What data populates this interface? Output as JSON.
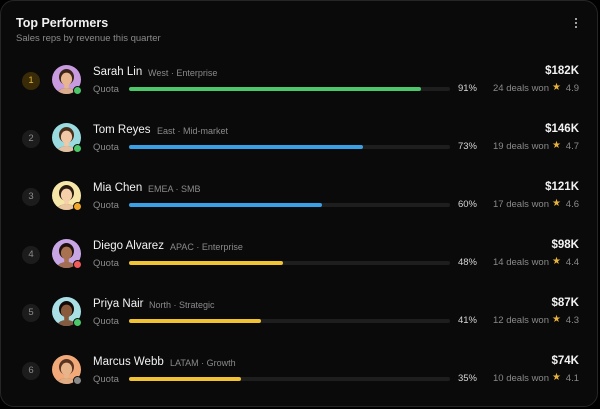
{
  "widget": {
    "title": "Top Performers",
    "subtitle": "Sales reps by revenue this quarter",
    "menu_icon": "more-vertical-icon"
  },
  "colors": {
    "green": "#4cc86a",
    "blue": "#3aa0e6",
    "yellow": "#f1c232",
    "status_online": "#4cc86a",
    "status_away": "#f1a82a",
    "status_busy": "#f05a5a",
    "status_offline": "#8a8a8a"
  },
  "reps": [
    {
      "rank": "1",
      "name": "Sarah Lin",
      "meta": "West · Enterprise",
      "quota_label": "Quota",
      "quota": 91,
      "pct": "91%",
      "deals": "24 deals won",
      "rating": "4.9",
      "revenue": "$182K",
      "bar_color": "#4cc86a",
      "status": "online",
      "avatar_bg": "#c89ae0",
      "skin": "#e7b58f",
      "hair": "#3a2418"
    },
    {
      "rank": "2",
      "name": "Tom Reyes",
      "meta": "East · Mid-market",
      "quota_label": "Quota",
      "quota": 73,
      "pct": "73%",
      "deals": "19 deals won",
      "rating": "4.7",
      "revenue": "$146K",
      "bar_color": "#3aa0e6",
      "status": "online",
      "avatar_bg": "#9adbe0",
      "skin": "#f0c8a6",
      "hair": "#4a2f1d"
    },
    {
      "rank": "3",
      "name": "Mia Chen",
      "meta": "EMEA · SMB",
      "quota_label": "Quota",
      "quota": 60,
      "pct": "60%",
      "deals": "17 deals won",
      "rating": "4.6",
      "revenue": "$121K",
      "bar_color": "#3aa0e6",
      "status": "away",
      "avatar_bg": "#f6e7a8",
      "skin": "#f4cfa9",
      "hair": "#2a1a12"
    },
    {
      "rank": "4",
      "name": "Diego Alvarez",
      "meta": "APAC · Enterprise",
      "quota_label": "Quota",
      "quota": 48,
      "pct": "48%",
      "deals": "14 deals won",
      "rating": "4.4",
      "revenue": "$98K",
      "bar_color": "#f1c232",
      "status": "busy",
      "avatar_bg": "#c8a6e6",
      "skin": "#a8714f",
      "hair": "#1d120c"
    },
    {
      "rank": "5",
      "name": "Priya Nair",
      "meta": "North · Strategic",
      "quota_label": "Quota",
      "quota": 41,
      "pct": "41%",
      "deals": "12 deals won",
      "rating": "4.3",
      "revenue": "$87K",
      "bar_color": "#f1c232",
      "status": "online",
      "avatar_bg": "#a8e0e6",
      "skin": "#8a5a3c",
      "hair": "#120b08"
    },
    {
      "rank": "6",
      "name": "Marcus Webb",
      "meta": "LATAM · Growth",
      "quota_label": "Quota",
      "quota": 35,
      "pct": "35%",
      "deals": "10 deals won",
      "rating": "4.1",
      "revenue": "$74K",
      "bar_color": "#f1c232",
      "status": "offline",
      "avatar_bg": "#f2a97a",
      "skin": "#e8b48a",
      "hair": "#5a3420"
    }
  ]
}
